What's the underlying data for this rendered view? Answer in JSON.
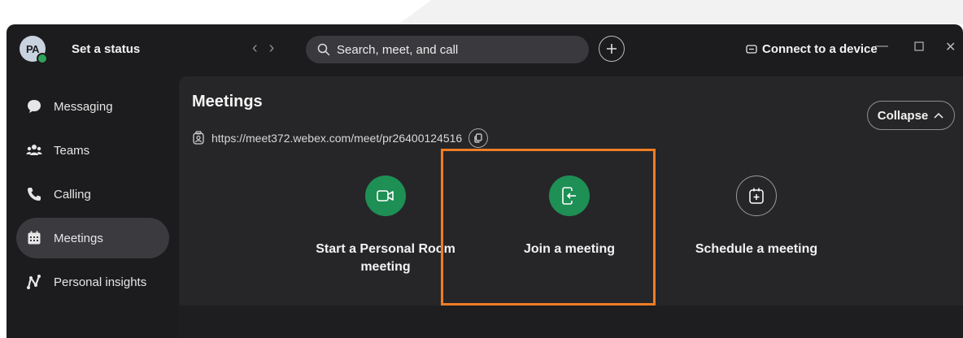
{
  "user": {
    "initials": "PA",
    "status_label": "Set a status"
  },
  "search": {
    "placeholder": "Search, meet, and call"
  },
  "header": {
    "connect_label": "Connect to a device"
  },
  "sidebar": {
    "items": [
      {
        "label": "Messaging",
        "icon": "chat-bubble-icon"
      },
      {
        "label": "Teams",
        "icon": "people-icon"
      },
      {
        "label": "Calling",
        "icon": "phone-icon"
      },
      {
        "label": "Meetings",
        "icon": "calendar-icon",
        "active": true
      },
      {
        "label": "Personal insights",
        "icon": "insights-icon"
      }
    ]
  },
  "main": {
    "title": "Meetings",
    "personal_room_url": "https://meet372.webex.com/meet/pr26400124516",
    "collapse_label": "Collapse",
    "actions": [
      {
        "line1": "Start a Personal Room",
        "line2": "meeting",
        "icon": "video-camera-icon",
        "highlighted": true
      },
      {
        "line1": "Join a meeting",
        "icon": "join-door-icon"
      },
      {
        "line1": "Schedule a meeting",
        "icon": "calendar-add-icon"
      }
    ]
  },
  "colors": {
    "accent_green": "#1e8f55",
    "highlight_orange": "#ef7d24",
    "window_bg": "#1c1c1e",
    "panel_bg": "#262628"
  }
}
